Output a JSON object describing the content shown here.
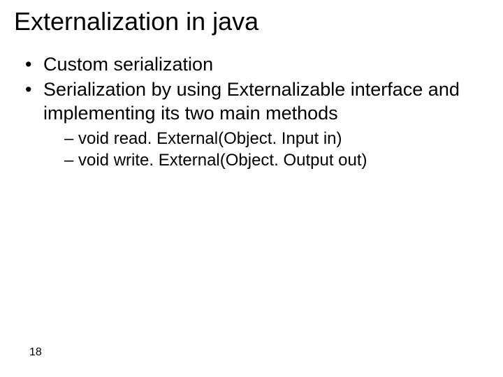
{
  "title": "Externalization in java",
  "bullets": [
    "Custom serialization",
    "Serialization by using Externalizable interface and implementing its two main methods"
  ],
  "sub_bullets": [
    "void read. External(Object. Input in)",
    "void write. External(Object. Output out)"
  ],
  "page_number": "18"
}
